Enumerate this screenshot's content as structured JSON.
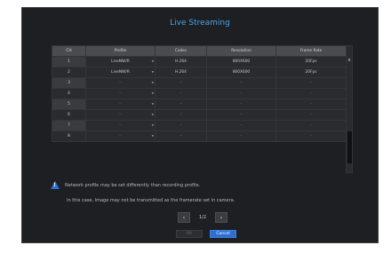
{
  "dialog": {
    "title": "Live Streaming",
    "columns": [
      "CH",
      "Profile",
      "Codec",
      "Resolution",
      "Frame Rate"
    ],
    "rows": [
      {
        "ch": "1",
        "profile": "LiveNW/R",
        "codec": "H.264",
        "resolution": "800X600",
        "frame_rate": "20Fps"
      },
      {
        "ch": "2",
        "profile": "LiveNW/R",
        "codec": "H.264",
        "resolution": "800X600",
        "frame_rate": "20Fps"
      },
      {
        "ch": "3",
        "profile": "--",
        "codec": "--",
        "resolution": "--",
        "frame_rate": "--"
      },
      {
        "ch": "4",
        "profile": "--",
        "codec": "--",
        "resolution": "--",
        "frame_rate": "--"
      },
      {
        "ch": "5",
        "profile": "--",
        "codec": "--",
        "resolution": "--",
        "frame_rate": "--"
      },
      {
        "ch": "6",
        "profile": "--",
        "codec": "--",
        "resolution": "--",
        "frame_rate": "--"
      },
      {
        "ch": "7",
        "profile": "--",
        "codec": "--",
        "resolution": "--",
        "frame_rate": "--"
      },
      {
        "ch": "8",
        "profile": "--",
        "codec": "--",
        "resolution": "--",
        "frame_rate": "--"
      }
    ],
    "note_line1": "Network profile may be set differently than recording profile.",
    "note_line2": "In this case, Image may not be transmitted as the framerate set in camera.",
    "pager": {
      "prev": "‹",
      "page": "1/2",
      "next": "›"
    },
    "ok_label": "OK",
    "cancel_label": "Cancel",
    "colors": {
      "accent": "#2f6fd1",
      "title": "#4aa3e8"
    }
  }
}
